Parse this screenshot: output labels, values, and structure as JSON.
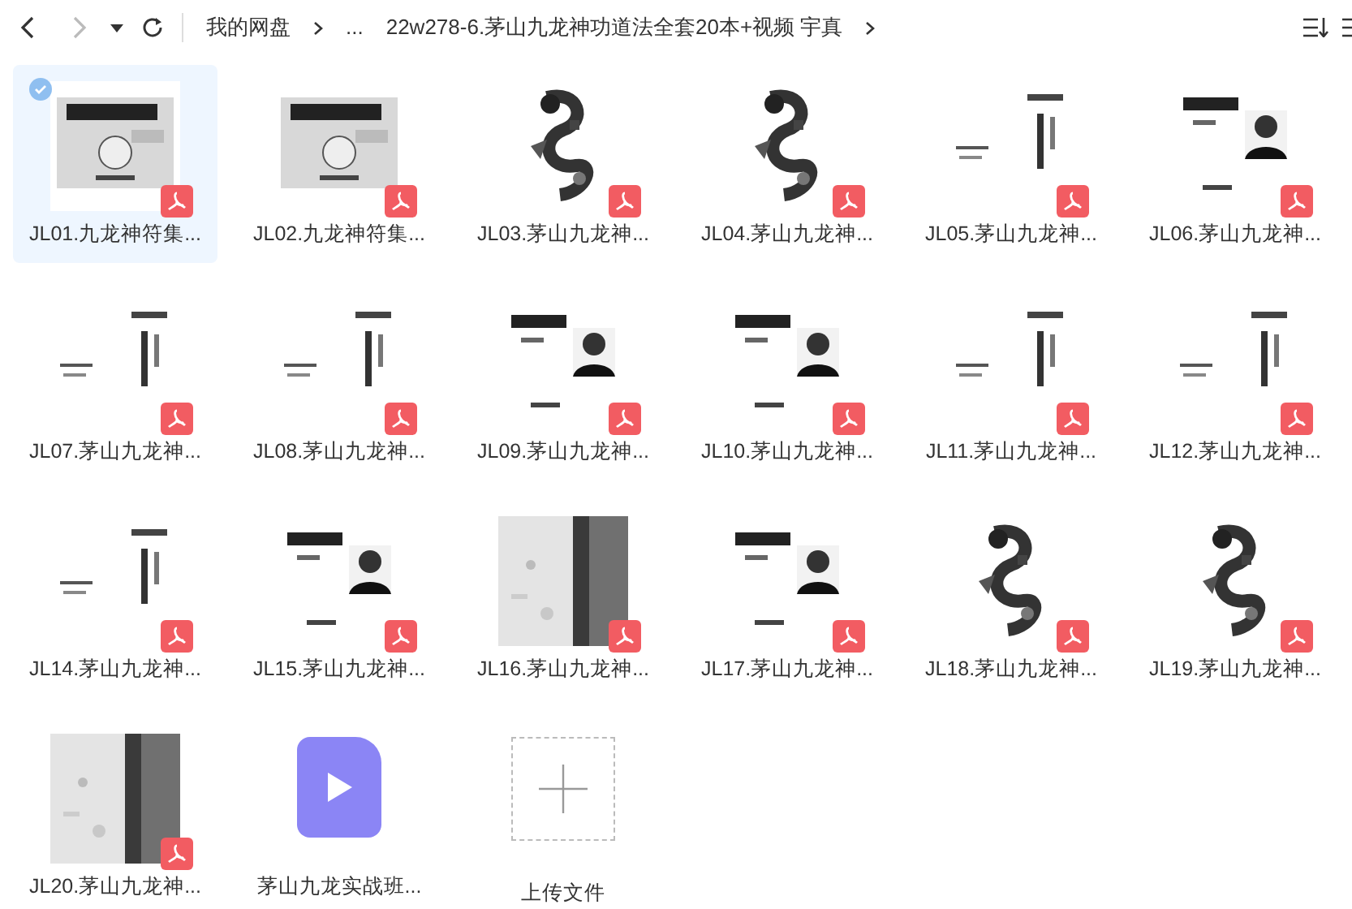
{
  "toolbar": {
    "back_enabled": true,
    "forward_enabled": false
  },
  "breadcrumb": [
    "我的网盘",
    "...",
    "22w278-6.茅山九龙神功道法全套20本+视频 宇真"
  ],
  "files": [
    {
      "kind": "pdf",
      "name": "JL01.九龙神符集...",
      "selected": true
    },
    {
      "kind": "pdf",
      "name": "JL02.九龙神符集...",
      "selected": false
    },
    {
      "kind": "pdf",
      "name": "JL03.茅山九龙神...",
      "selected": false
    },
    {
      "kind": "pdf",
      "name": "JL04.茅山九龙神...",
      "selected": false
    },
    {
      "kind": "pdf",
      "name": "JL05.茅山九龙神...",
      "selected": false
    },
    {
      "kind": "pdf",
      "name": "JL06.茅山九龙神...",
      "selected": false
    },
    {
      "kind": "pdf",
      "name": "JL07.茅山九龙神...",
      "selected": false
    },
    {
      "kind": "pdf",
      "name": "JL08.茅山九龙神...",
      "selected": false
    },
    {
      "kind": "pdf",
      "name": "JL09.茅山九龙神...",
      "selected": false
    },
    {
      "kind": "pdf",
      "name": "JL10.茅山九龙神...",
      "selected": false
    },
    {
      "kind": "pdf",
      "name": "JL11.茅山九龙神...",
      "selected": false
    },
    {
      "kind": "pdf",
      "name": "JL12.茅山九龙神...",
      "selected": false
    },
    {
      "kind": "pdf",
      "name": "JL14.茅山九龙神...",
      "selected": false
    },
    {
      "kind": "pdf",
      "name": "JL15.茅山九龙神...",
      "selected": false
    },
    {
      "kind": "pdf",
      "name": "JL16.茅山九龙神...",
      "selected": false
    },
    {
      "kind": "pdf",
      "name": "JL17.茅山九龙神...",
      "selected": false
    },
    {
      "kind": "pdf",
      "name": "JL18.茅山九龙神...",
      "selected": false
    },
    {
      "kind": "pdf",
      "name": "JL19.茅山九龙神...",
      "selected": false
    },
    {
      "kind": "pdf",
      "name": "JL20.茅山九龙神...",
      "selected": false
    },
    {
      "kind": "video",
      "name": "茅山九龙实战班...",
      "selected": false
    },
    {
      "kind": "upload",
      "name": "上传文件"
    }
  ]
}
